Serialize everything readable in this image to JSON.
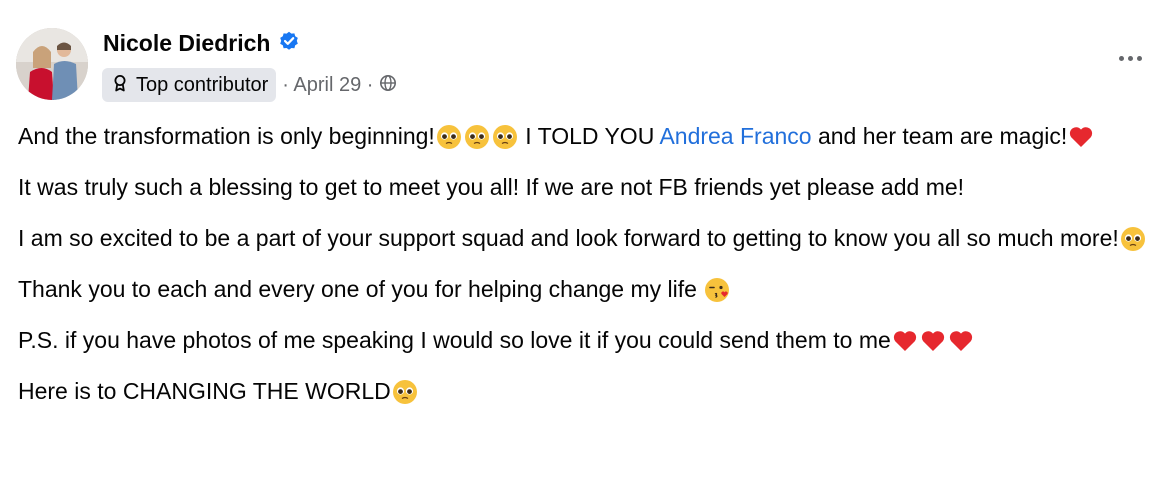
{
  "post": {
    "author": "Nicole Diedrich",
    "badge_label": "Top contributor",
    "date_text": "· April 29 ·",
    "line1_a": "And the transformation is only beginning!",
    "line1_b": " I TOLD YOU ",
    "mention": "Andrea Franco",
    "line1_c": " and her team are magic!",
    "line2": "It was truly such a blessing to get to meet you all! If we are not FB friends yet please add me!",
    "line3": "I am so excited to be a part of your support squad and look forward to getting to know you all so much more!",
    "line4": "Thank you to each and every one of you for helping change my life ",
    "line5": "P.S. if you have photos of me speaking I would so love it if you could send them to me",
    "line6": "Here is to CHANGING THE WORLD",
    "icons": {
      "verified": "verified-badge-icon",
      "badge": "top-contributor-icon",
      "audience": "globe-icon",
      "more": "more-options-icon",
      "emojis": [
        "pleading-face",
        "red-heart",
        "face-blowing-kiss"
      ]
    },
    "colors": {
      "link": "#216fdb",
      "verified": "#1877f2",
      "meta": "#65676b",
      "badge_bg": "#e4e6eb"
    }
  }
}
